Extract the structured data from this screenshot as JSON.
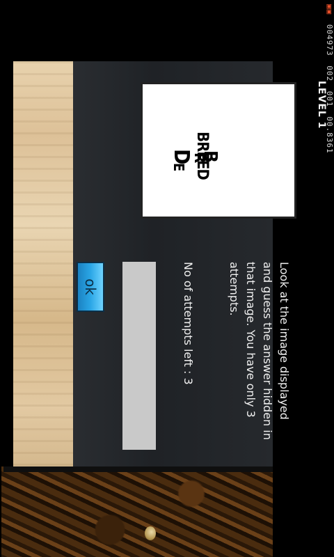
{
  "status_bar": {
    "alert_text": "▣▣",
    "field_1": "004973",
    "field_2": "002",
    "field_3": "001",
    "field_4": "00.8361"
  },
  "level": {
    "title": "LEVEL 1"
  },
  "puzzle": {
    "glyph_b": "B",
    "glyph_r": "R",
    "glyph_breed": "BREED",
    "glyph_e": "E",
    "glyph_d": "D"
  },
  "instructions": {
    "text": "Look at the image displayed and guess the answer hidden in that image. You have only 3 attempts."
  },
  "attempts": {
    "text": "No of attempts left :   3"
  },
  "answer": {
    "value": "",
    "placeholder": ""
  },
  "ok_button": {
    "label": "ok"
  },
  "colors": {
    "status_alert": "#e8502a",
    "board": "#23262a",
    "button": "#2aa6e6",
    "input": "#c9c9c9",
    "wood": "#e0c8a0",
    "floor": "#4a2c0f"
  }
}
